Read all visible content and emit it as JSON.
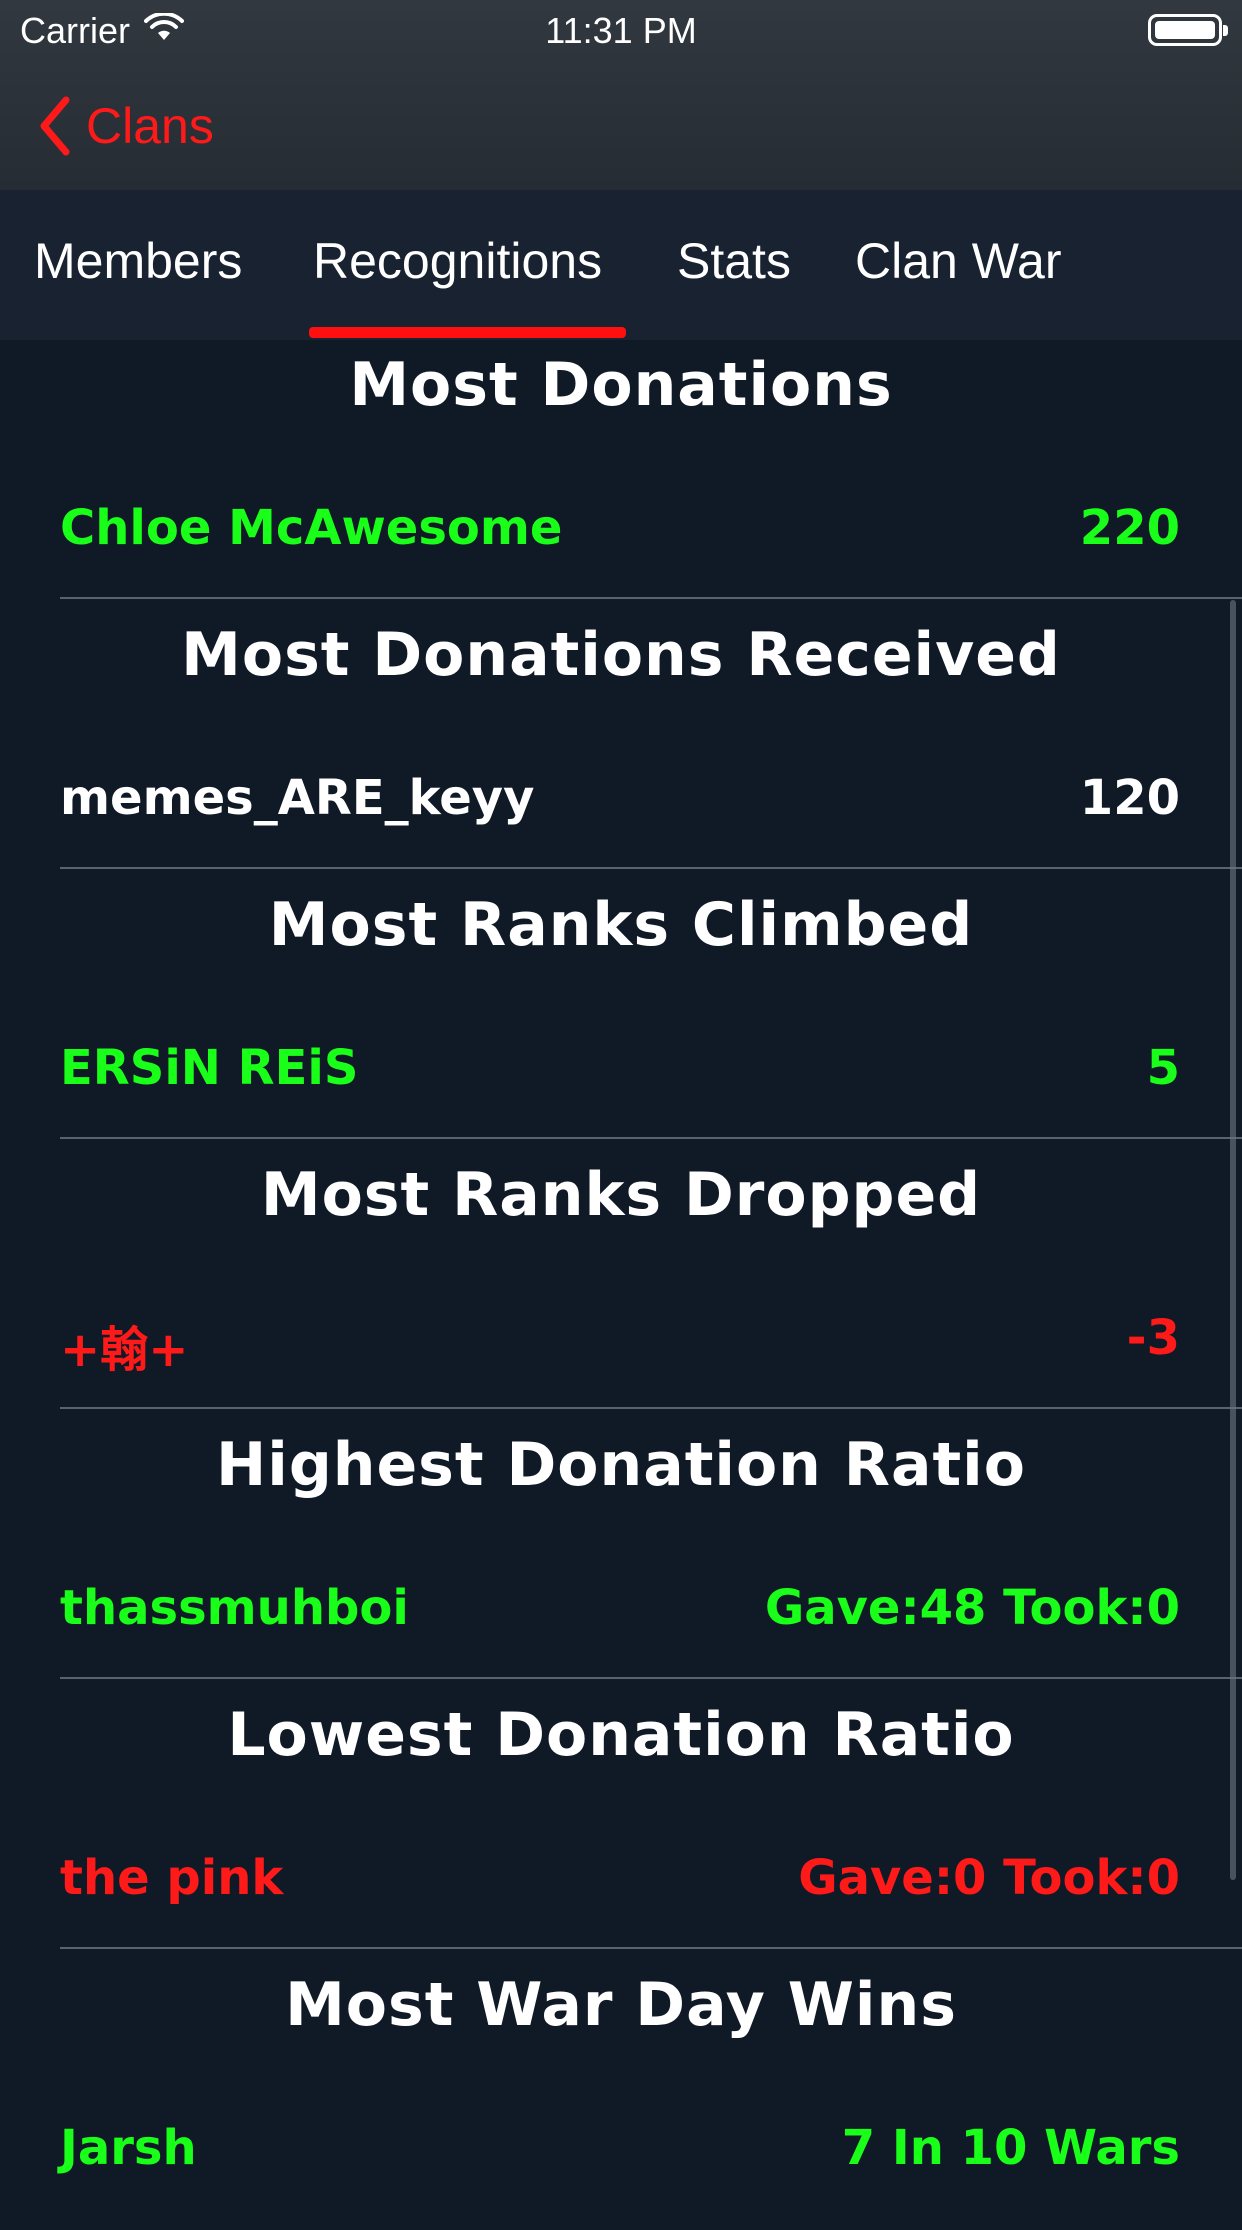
{
  "status_bar": {
    "carrier": "Carrier",
    "time": "11:31 PM"
  },
  "nav": {
    "back_label": "Clans"
  },
  "tabs": [
    {
      "label": "Members"
    },
    {
      "label": "Recognitions"
    },
    {
      "label": "Stats"
    },
    {
      "label": "Clan War"
    }
  ],
  "active_tab": "Recognitions",
  "colors": {
    "positive": "#1aff1a",
    "negative": "#ff1a1a",
    "neutral": "#ffffff",
    "accent": "#ff1010"
  },
  "recognitions": [
    {
      "title": "Most Donations",
      "name": "Chloe McAwesome",
      "value": "220",
      "color": "#1aff1a"
    },
    {
      "title": "Most Donations Received",
      "name": "memes_ARE_keyy",
      "value": "120",
      "color": "#ffffff"
    },
    {
      "title": "Most Ranks Climbed",
      "name": "ERSiN REiS",
      "value": "5",
      "color": "#1aff1a"
    },
    {
      "title": "Most Ranks Dropped",
      "name": "+翰+",
      "value": "-3",
      "color": "#ff1a1a"
    },
    {
      "title": "Highest Donation Ratio",
      "name": "thassmuhboi",
      "value": "Gave:48 Took:0",
      "color": "#1aff1a"
    },
    {
      "title": "Lowest Donation Ratio",
      "name": "the pink",
      "value": "Gave:0 Took:0",
      "color": "#ff1a1a"
    },
    {
      "title": "Most War Day Wins",
      "name": "Jarsh",
      "value": "7 In 10 Wars",
      "color": "#1aff1a"
    }
  ]
}
